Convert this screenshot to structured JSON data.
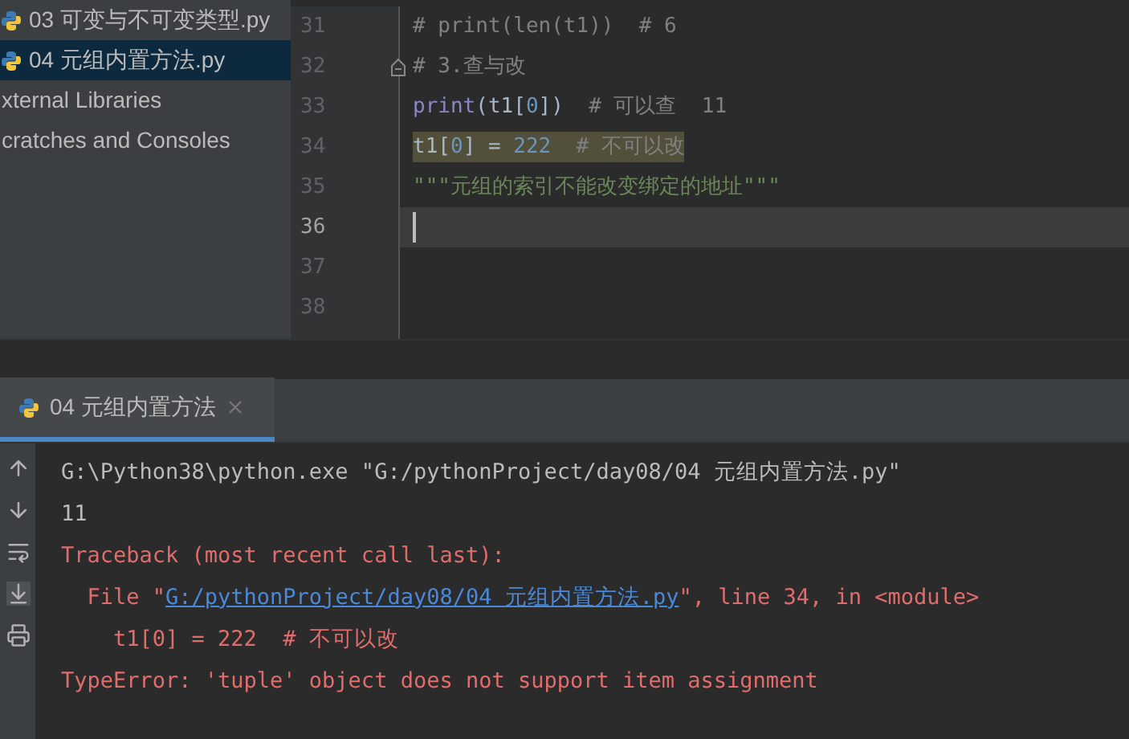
{
  "project_tree": {
    "items": [
      {
        "label": "03 可变与不可变类型.py",
        "kind": "file",
        "selected": false
      },
      {
        "label": "04 元组内置方法.py",
        "kind": "file",
        "selected": true
      },
      {
        "label": "xternal Libraries",
        "kind": "group",
        "selected": false
      },
      {
        "label": "cratches and Consoles",
        "kind": "group",
        "selected": false
      }
    ]
  },
  "editor": {
    "lines": [
      {
        "number": "31",
        "highlighted": false,
        "current": false,
        "fold": false,
        "tokens": [
          {
            "kind": "comment",
            "text": "# print(len(t1))  # 6"
          }
        ]
      },
      {
        "number": "32",
        "highlighted": false,
        "current": false,
        "fold": true,
        "tokens": [
          {
            "kind": "comment",
            "text": "# 3.查与改"
          }
        ]
      },
      {
        "number": "33",
        "highlighted": false,
        "current": false,
        "fold": false,
        "tokens": [
          {
            "kind": "builtin",
            "text": "print"
          },
          {
            "kind": "plain",
            "text": "(t1["
          },
          {
            "kind": "number",
            "text": "0"
          },
          {
            "kind": "plain",
            "text": "])"
          },
          {
            "kind": "comment",
            "text": "  # 可以查  11"
          }
        ]
      },
      {
        "number": "34",
        "highlighted": true,
        "current": false,
        "fold": false,
        "tokens": [
          {
            "kind": "plain",
            "text": "t1["
          },
          {
            "kind": "number",
            "text": "0"
          },
          {
            "kind": "plain",
            "text": "] = "
          },
          {
            "kind": "number",
            "text": "222"
          },
          {
            "kind": "comment",
            "text": "  # 不可以改"
          }
        ]
      },
      {
        "number": "35",
        "highlighted": false,
        "current": false,
        "fold": false,
        "tokens": [
          {
            "kind": "string",
            "text": "\"\"\"元组的索引不能改变绑定的地址\"\"\""
          }
        ]
      },
      {
        "number": "36",
        "highlighted": false,
        "current": true,
        "fold": false
      },
      {
        "number": "37",
        "highlighted": false,
        "current": false,
        "fold": false
      },
      {
        "number": "38",
        "highlighted": false,
        "current": false,
        "fold": false
      }
    ]
  },
  "run_panel": {
    "tab": {
      "label": "04 元组内置方法",
      "selected": true
    },
    "console": [
      {
        "kind": "normal",
        "segments": [
          {
            "kind": "text",
            "text": "G:\\Python38\\python.exe \"G:/pythonProject/day08/04 元组内置方法.py\""
          }
        ]
      },
      {
        "kind": "normal",
        "segments": [
          {
            "kind": "text",
            "text": "11"
          }
        ]
      },
      {
        "kind": "error",
        "segments": [
          {
            "kind": "text",
            "text": "Traceback (most recent call last):"
          }
        ]
      },
      {
        "kind": "error",
        "segments": [
          {
            "kind": "text",
            "text": "  File \""
          },
          {
            "kind": "link",
            "text": "G:/pythonProject/day08/04 元组内置方法.py"
          },
          {
            "kind": "text",
            "text": "\", line 34, in <module>"
          }
        ]
      },
      {
        "kind": "error",
        "segments": [
          {
            "kind": "text",
            "text": "    t1[0] = 222  # 不可以改"
          }
        ]
      },
      {
        "kind": "error",
        "segments": [
          {
            "kind": "text",
            "text": "TypeError: 'tuple' object does not support item assignment"
          }
        ]
      }
    ]
  }
}
